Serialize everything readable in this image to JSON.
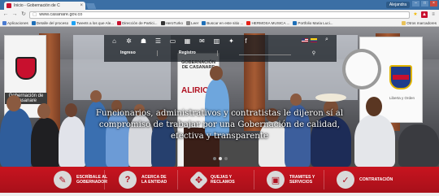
{
  "browser": {
    "tab_title": "Inicio - Gobernación de C",
    "tab_close": "×",
    "user_name": "Alejandra",
    "url": "www.casanare.gov.co",
    "bookmarks": [
      {
        "label": "Aplicaciones",
        "color": "#4a7bd0"
      },
      {
        "label": "Detalle del proceso",
        "color": "#1e6fb7"
      },
      {
        "label": "Tweets a los que Ale...",
        "color": "#1da1f2"
      },
      {
        "label": "Dirección de Partici...",
        "color": "#c8102e"
      },
      {
        "label": "HeroTurko",
        "color": "#333333"
      },
      {
        "label": "Leer",
        "color": "#888888"
      },
      {
        "label": "Buscar en este sitio ...",
        "color": "#1e6fb7"
      },
      {
        "label": "HERMOSA MUSICA ...",
        "color": "#e62117"
      },
      {
        "label": "Portfolio Maria Luci...",
        "color": "#1e6fb7"
      }
    ],
    "bookmarks_more": "Otros marcadores"
  },
  "site": {
    "header_links": {
      "ingreso": "Ingreso",
      "registro": "Registro"
    },
    "banners": {
      "left_label": "Gobernación de Casanare",
      "center_title": "GOBERNACIÓN DE CASANARE",
      "center_text": "ALIRIO",
      "right_label": "Liberta y Orden"
    },
    "slide_caption": "Funcionarios, administrativos y contratistas le dijeron sí al compromiso de trabajar por una Gobernación de calidad, efectiva y transparente",
    "quick_links": [
      {
        "line1": "Escríbale al",
        "line2": "gobernador",
        "icon": "pencil-icon",
        "glyph": "✎"
      },
      {
        "line1": "Acerca de",
        "line2": "la entidad",
        "icon": "question-icon",
        "glyph": "?"
      },
      {
        "line1": "Quejas y",
        "line2": "reclamos",
        "icon": "grid-icon",
        "glyph": "✥"
      },
      {
        "line1": "Tramites y",
        "line2": "servicios",
        "icon": "briefcase-icon",
        "glyph": "▣"
      },
      {
        "line1": "Contratación",
        "line2": "",
        "icon": "tag-icon",
        "glyph": "✓"
      }
    ]
  }
}
